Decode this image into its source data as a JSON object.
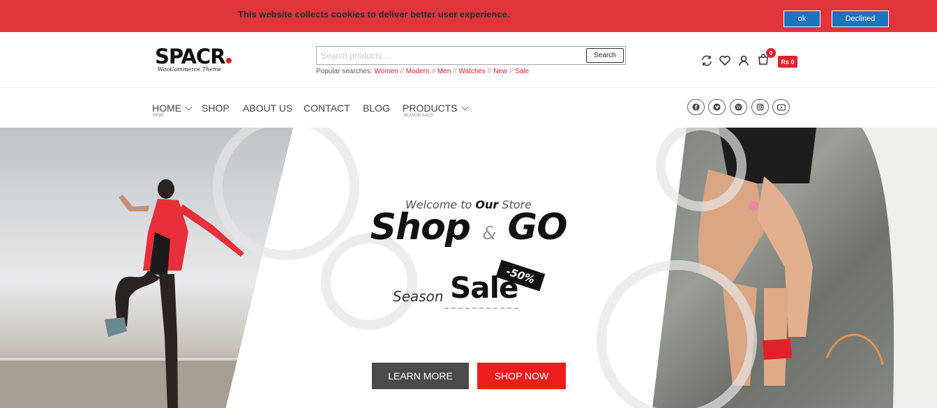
{
  "cookie": {
    "message": "This website collects cookies to deliver better user experience.",
    "ok_label": "ok",
    "declined_label": "Declined"
  },
  "header": {
    "logo_text": "SPACR",
    "logo_tagline": "WooCommerce Theme",
    "search_placeholder": "Search products....",
    "search_button": "Search",
    "popular_label": "Popular searches: ",
    "popular_links": [
      "Women",
      "Modern",
      "Men",
      "Watches",
      "New",
      "Sale"
    ],
    "popular_separator": " // ",
    "cart_count": "0",
    "cart_total": "Rs 0",
    "icons": [
      "refresh-icon",
      "heart-icon",
      "user-icon",
      "cart-icon"
    ]
  },
  "nav": {
    "items": [
      {
        "label": "HOME",
        "sub": "NEW!"
      },
      {
        "label": "SHOP",
        "sub": ""
      },
      {
        "label": "ABOUT US",
        "sub": ""
      },
      {
        "label": "CONTACT",
        "sub": ""
      },
      {
        "label": "BLOG",
        "sub": ""
      },
      {
        "label": "PRODUCTS",
        "sub": "SEASON SALE!"
      }
    ],
    "social_icons": [
      "facebook-icon",
      "twitter-icon",
      "wordpress-icon",
      "instagram-icon",
      "youtube-icon"
    ]
  },
  "hero": {
    "welcome_pre": "Welcome to ",
    "welcome_bold": "Our",
    "welcome_post": " Store",
    "title_left": "Shop",
    "title_amp": "&",
    "title_right": "GO",
    "season_label": "Season",
    "sale_label": "Sale",
    "discount": "-50%",
    "learn_more": "LEARN MORE",
    "shop_now": "SHOP NOW"
  },
  "colors": {
    "brand_red": "#e0353a",
    "accent_red": "#ee1c1c",
    "cookie_button_blue": "#1e73be",
    "dark_button": "#4a4a4a"
  }
}
